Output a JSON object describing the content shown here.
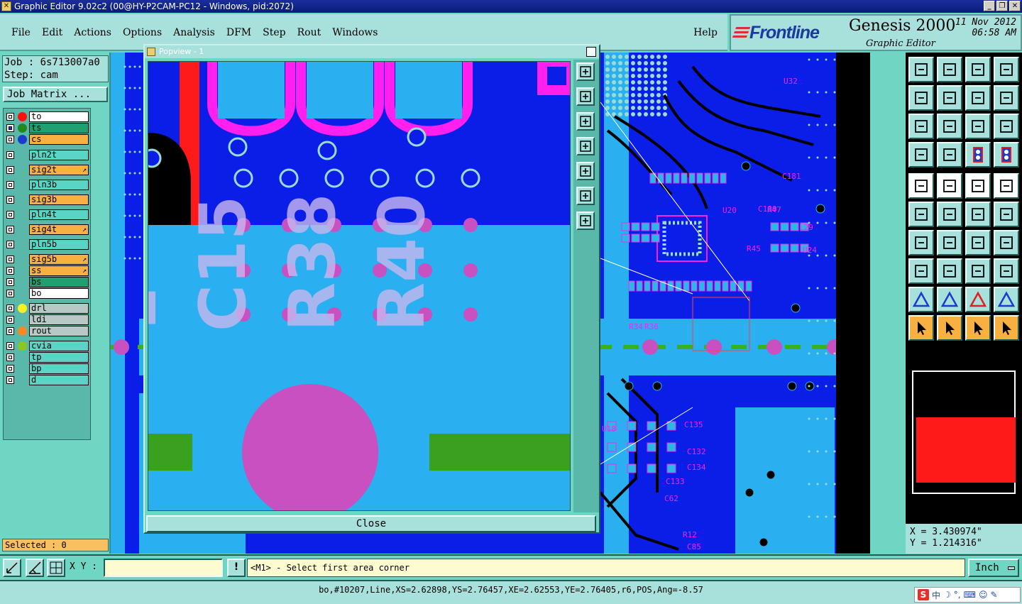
{
  "window": {
    "title": "Graphic Editor 9.02c2 (00@HY-P2CAM-PC12 - Windows, pid:2072)"
  },
  "menubar": {
    "items": [
      "File",
      "Edit",
      "Actions",
      "Options",
      "Analysis",
      "DFM",
      "Step",
      "Rout",
      "Windows"
    ],
    "help": "Help"
  },
  "brand": {
    "logo": "Frontline",
    "product": "Genesis 2000",
    "subtitle": "Graphic Editor",
    "date": "11 Nov 2012",
    "time": "06:58 AM"
  },
  "job": {
    "job_line": "Job : 6s713007a0",
    "step_line": "Step: cam",
    "matrix_button": "Job Matrix ..."
  },
  "layers": [
    {
      "name": "to",
      "bg": "#ffffff",
      "dot": "#ff1010",
      "checked": false
    },
    {
      "name": "ts",
      "bg": "#20a070",
      "dot": "#208a20",
      "checked": true
    },
    {
      "name": "cs",
      "bg": "#f8b040",
      "dot": "#1a3ad0",
      "checked": false
    },
    {
      "name": "pln2t",
      "bg": "#5ad4c4",
      "dot": "",
      "checked": false
    },
    {
      "name": "sig2t",
      "bg": "#f8b040",
      "dot": "",
      "checked": false
    },
    {
      "name": "pln3b",
      "bg": "#5ad4c4",
      "dot": "",
      "checked": false
    },
    {
      "name": "sig3b",
      "bg": "#f8b040",
      "dot": "",
      "checked": false
    },
    {
      "name": "pln4t",
      "bg": "#5ad4c4",
      "dot": "",
      "checked": false
    },
    {
      "name": "sig4t",
      "bg": "#f8b040",
      "dot": "",
      "checked": false
    },
    {
      "name": "pln5b",
      "bg": "#5ad4c4",
      "dot": "",
      "checked": false
    },
    {
      "name": "sig5b",
      "bg": "#f8b040",
      "dot": "",
      "checked": false
    },
    {
      "name": "ss",
      "bg": "#f8b040",
      "dot": "",
      "checked": false
    },
    {
      "name": "bs",
      "bg": "#20a070",
      "dot": "",
      "checked": false
    },
    {
      "name": "bo",
      "bg": "#ffffff",
      "dot": "",
      "checked": false
    },
    {
      "name": "drl",
      "bg": "#b8c8c4",
      "dot": "#f8f020",
      "checked": false
    },
    {
      "name": "ldi",
      "bg": "#b8c8c4",
      "dot": "",
      "checked": false
    },
    {
      "name": "rout",
      "bg": "#b8c8c4",
      "dot": "#f88a20",
      "checked": false
    },
    {
      "name": "cvia",
      "bg": "#5ad4c4",
      "dot": "#88c820",
      "checked": false
    },
    {
      "name": "tp",
      "bg": "#5ad4c4",
      "dot": "",
      "checked": false
    },
    {
      "name": "bp",
      "bg": "#5ad4c4",
      "dot": "",
      "checked": false
    },
    {
      "name": "d",
      "bg": "#5ad4c4",
      "dot": "",
      "checked": false
    }
  ],
  "selected": "Selected : 0",
  "popview": {
    "title": "Popview - 1",
    "close_label": "Close",
    "close_x": "✕"
  },
  "canvas_labels": [
    "U32",
    "U20",
    "C180",
    "C181",
    "R47",
    "L29",
    "U24",
    "R45",
    "C135",
    "C132",
    "C134",
    "C133",
    "C62",
    "U18",
    "R34",
    "R36",
    "C85",
    "R12"
  ],
  "coords": {
    "x": "X = 3.430974\"",
    "y": "Y = 1.214316\""
  },
  "bottom": {
    "xy_label": "X Y :",
    "xy_value": "",
    "bang": "!",
    "prompt": "<M1> - Select first area corner",
    "units": "Inch"
  },
  "status": "bo,#10207,Line,XS=2.62898,YS=2.76457,XE=2.62553,YE=2.76405,r6,POS,Ang=-8.57",
  "colors": {
    "pcb_blue": "#0a1ee8",
    "pcb_light": "#2ab0f0",
    "magenta": "#ff20f0",
    "panel": "#6fd6c4"
  }
}
